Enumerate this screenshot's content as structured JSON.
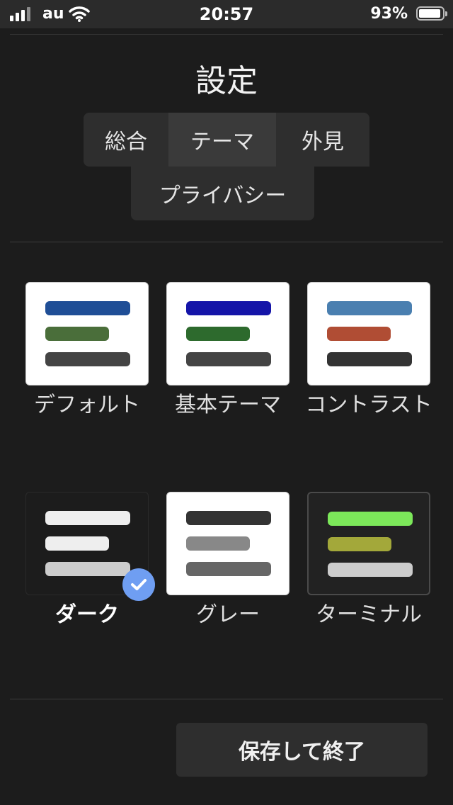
{
  "status_bar": {
    "carrier": "au",
    "time": "20:57",
    "battery_percent": "93%",
    "icons": [
      "signal-icon",
      "wifi-icon",
      "battery-icon"
    ]
  },
  "title": "設定",
  "tabs": [
    {
      "label": "総合",
      "active": false
    },
    {
      "label": "テーマ",
      "active": true
    },
    {
      "label": "外見",
      "active": false
    },
    {
      "label": "プライバシー",
      "active": false
    }
  ],
  "themes": [
    {
      "label": "デフォルト",
      "card_bg": "#ffffff",
      "bars": [
        "#1f4e96",
        "#4a6e3a",
        "#444444"
      ],
      "selected": false
    },
    {
      "label": "基本テーマ",
      "card_bg": "#ffffff",
      "bars": [
        "#1414a8",
        "#2d6a2d",
        "#444444"
      ],
      "selected": false
    },
    {
      "label": "コントラスト",
      "card_bg": "#ffffff",
      "bars": [
        "#4a7fb0",
        "#b04d34",
        "#333333"
      ],
      "selected": false
    },
    {
      "label": "ダーク",
      "card_bg": "#1c1c1c",
      "bars": [
        "#eeeeee",
        "#eeeeee",
        "#cccccc"
      ],
      "selected": true
    },
    {
      "label": "グレー",
      "card_bg": "#ffffff",
      "bars": [
        "#333333",
        "#888888",
        "#666666"
      ],
      "selected": false
    },
    {
      "label": "ターミナル",
      "card_bg": "#222222",
      "bars": [
        "#7ce85a",
        "#a3a83a",
        "#cccccc"
      ],
      "selected": false
    }
  ],
  "save_button": "保存して終了",
  "colors": {
    "background": "#1c1c1c",
    "accent_check": "#6f9ef2"
  }
}
